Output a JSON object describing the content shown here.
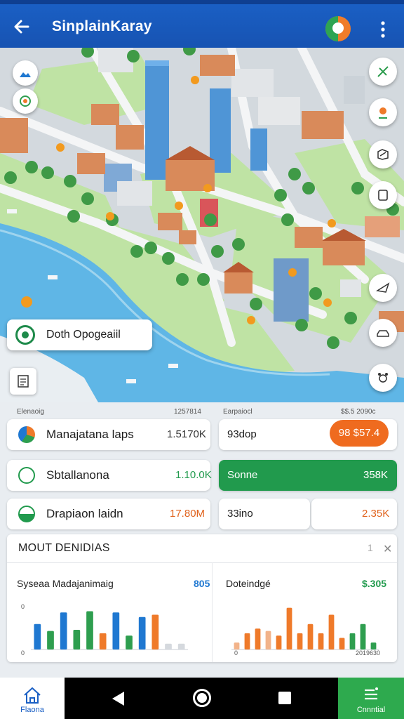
{
  "app": {
    "title": "SinplainKaray",
    "back_icon": "arrow-left-icon",
    "avatar_icon": "user-avatar-icon",
    "more_icon": "more-vertical-icon",
    "brand_color": "#1a5fc4"
  },
  "map": {
    "place_card_label": "Doth Opogeaiil",
    "map_buttons": [
      "route-icon",
      "location-pin-icon",
      "map-edit-icon",
      "layers-icon",
      "chat-icon",
      "car-icon",
      "pets-icon"
    ]
  },
  "stats": {
    "card1": {
      "caption_left": "Elenaoig",
      "caption_right": "1257814",
      "label": "Manajatana laps",
      "value": "1.5170K"
    },
    "card2": {
      "caption_left": "Earpaiocl",
      "caption_right": "$$.5 2090c",
      "label": "93dop",
      "pill": "98 $57.4"
    },
    "row2_left": {
      "label": "Sbtallanona",
      "value": "1.10.0K"
    },
    "row2_right": {
      "label": "Sonne",
      "value": "358K"
    },
    "row3_left": {
      "label": "Drapiaon laidn",
      "value": "17.80M"
    },
    "row3_right": {
      "label": "33ino",
      "value": "2.35K"
    }
  },
  "metrics": {
    "title": "MOUT DENIDIAS",
    "count": "1",
    "left_chart": {
      "title": "Syseaa Madajanimaig",
      "value": "805",
      "value_color": "#1f78d1"
    },
    "right_chart": {
      "title": "Doteindgé",
      "value": "$.305",
      "value_color": "#219a4d"
    }
  },
  "chart_data": [
    {
      "type": "bar",
      "title": "Syseaa Madajanimaig",
      "ylabel_ticks": [
        "0",
        "0"
      ],
      "values": [
        22,
        16,
        32,
        17,
        33,
        14,
        32,
        12,
        28,
        30,
        5,
        5
      ],
      "colors": [
        "#1f78d1",
        "#2e9e4f",
        "#1f78d1",
        "#2e9e4f",
        "#2e9e4f",
        "#ef7a2a",
        "#1f78d1",
        "#2e9e4f",
        "#1f78d1",
        "#ef7a2a",
        "#d5d9de",
        "#d5d9de"
      ],
      "ylim": [
        0,
        40
      ]
    },
    {
      "type": "bar",
      "title": "Doteindgé",
      "x_end_label": "2019630",
      "y_start_label": "0",
      "values": [
        6,
        14,
        18,
        16,
        12,
        36,
        14,
        22,
        14,
        30,
        10,
        14,
        22,
        6
      ],
      "colors": [
        "#f2b38a",
        "#ef7a2a",
        "#ef7a2a",
        "#f2b38a",
        "#ef7a2a",
        "#ef7a2a",
        "#ef7a2a",
        "#ef7a2a",
        "#ef7a2a",
        "#ef7a2a",
        "#ef7a2a",
        "#2e9e4f",
        "#2e9e4f",
        "#2e9e4f"
      ],
      "ylim": [
        0,
        40
      ]
    }
  ],
  "nav": {
    "home_label": "Flaona",
    "home_icon": "home-icon",
    "right_label": "Cnnntial",
    "right_icon": "menu-list-icon"
  }
}
